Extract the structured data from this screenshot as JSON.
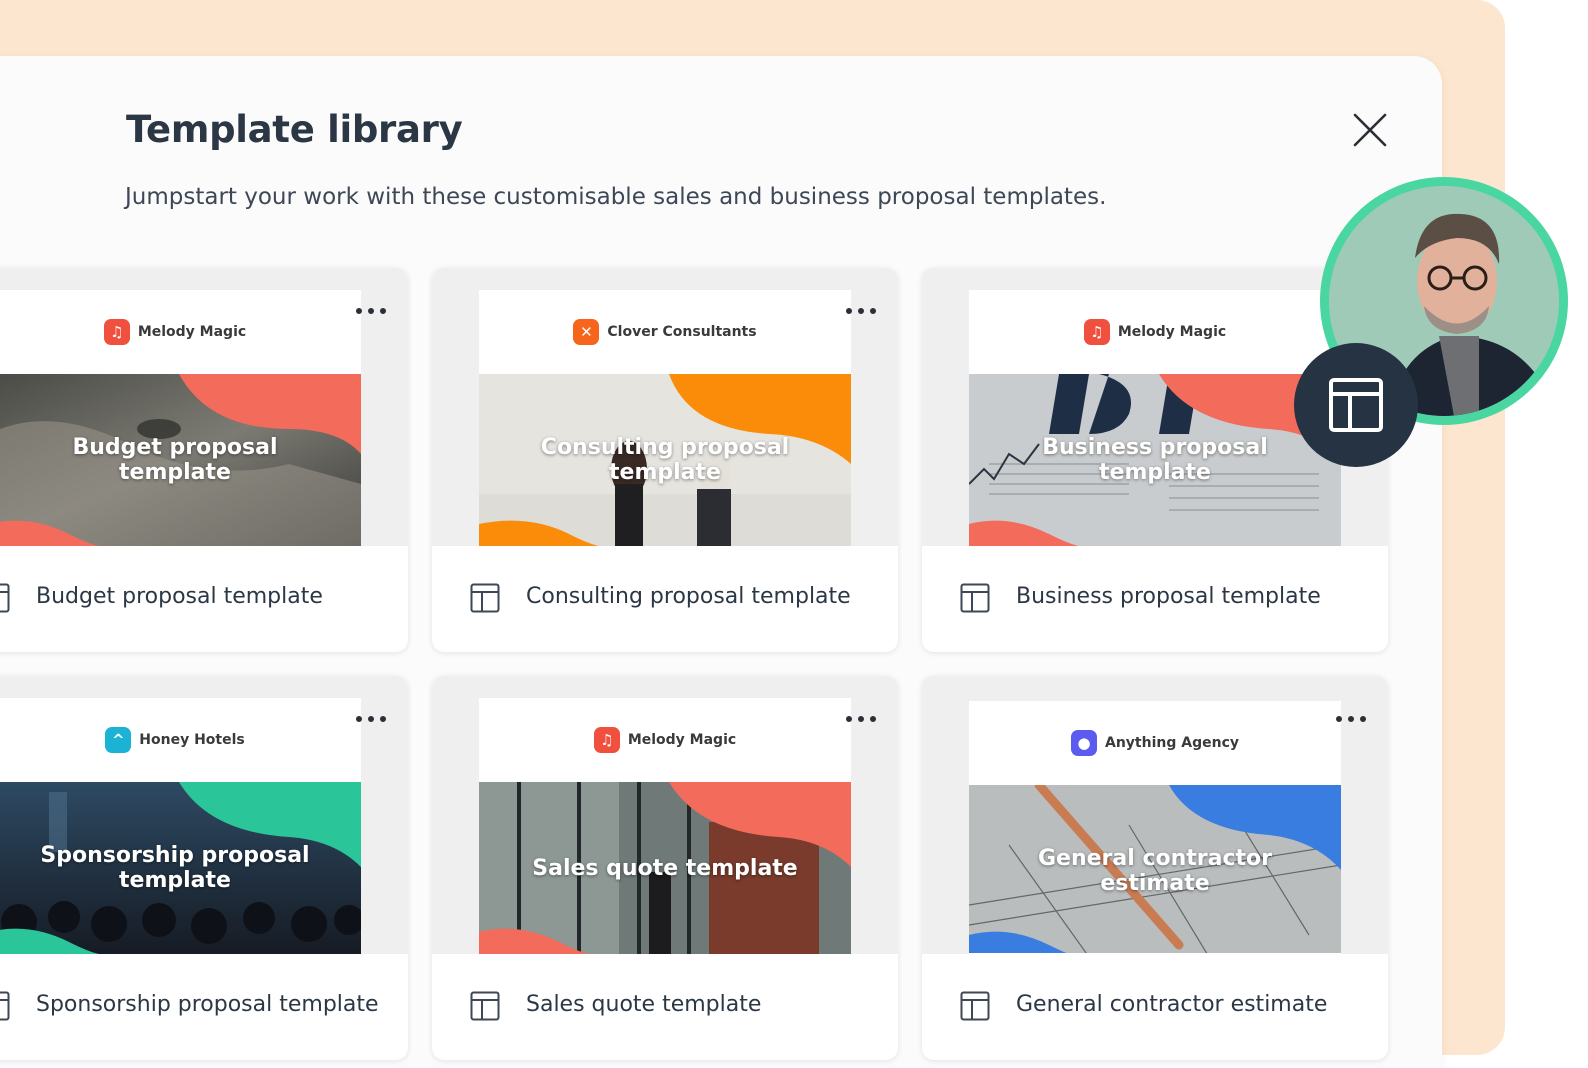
{
  "modal": {
    "title": "Template library",
    "subtitle": "Jumpstart your work with these customisable sales and business proposal templates."
  },
  "cards": [
    {
      "brand": "Melody Magic",
      "brand_logo_color": "#f0503d",
      "hero_title": "Budget proposal template",
      "label": "Budget proposal template",
      "accent": "#f26b5b"
    },
    {
      "brand": "Clover Consultants",
      "brand_logo_color": "#f7641c",
      "hero_title": "Consulting proposal template",
      "label": "Consulting proposal template",
      "accent": "#fb8c0a"
    },
    {
      "brand": "Melody Magic",
      "brand_logo_color": "#f0503d",
      "hero_title": "Business proposal template",
      "label": "Business proposal template",
      "accent": "#f26b5b"
    },
    {
      "brand": "Honey Hotels",
      "brand_logo_color": "#1ab3d6",
      "hero_title": "Sponsorship proposal template",
      "label": "Sponsorship proposal template",
      "accent": "#2bc59a"
    },
    {
      "brand": "Melody Magic",
      "brand_logo_color": "#f0503d",
      "hero_title": "Sales quote template",
      "label": "Sales quote template",
      "accent": "#f26b5b"
    },
    {
      "brand": "Anything Agency",
      "brand_logo_color": "#5b5bf0",
      "hero_title": "General contractor estimate",
      "label": "General contractor estimate",
      "accent": "#3a7de0"
    }
  ],
  "colors": {
    "peach_background": "#fde6cf",
    "avatar_ring": "#4ad6a0",
    "avatar_badge": "#253343",
    "title_text": "#2c3746"
  },
  "icons": {
    "close": "close-icon",
    "more": "more-options-icon",
    "template": "template-layout-icon"
  }
}
